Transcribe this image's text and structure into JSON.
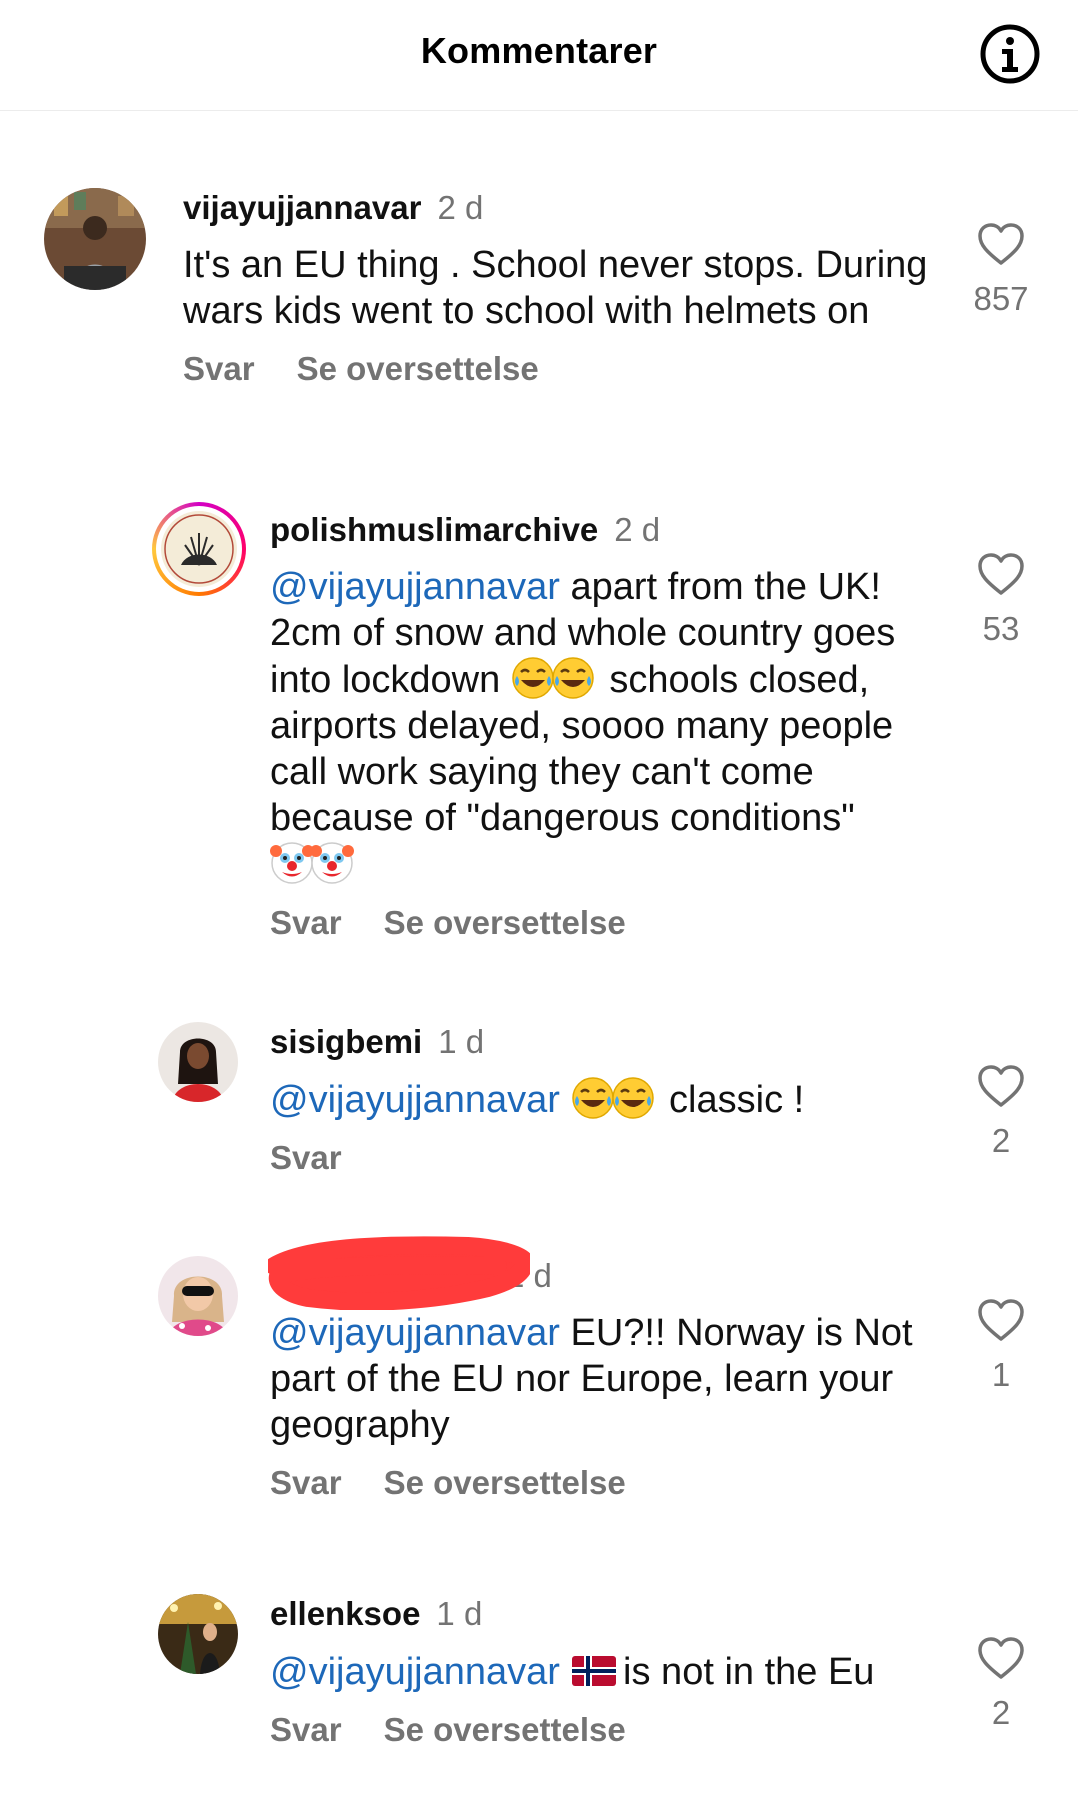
{
  "header": {
    "title": "Kommentarer",
    "info_icon": "info-circle-icon"
  },
  "colors": {
    "mention": "#1d68b9",
    "muted": "#737373",
    "redaction": "#ff3b3b"
  },
  "comments": [
    {
      "username": "vijayujjannavar",
      "time": "2 d",
      "text": "It's an EU thing . School never stops. During wars kids went to school with helmets on",
      "reply_label": "Svar",
      "translate_label": "Se oversettelse",
      "likes": "857"
    },
    {
      "username": "polishmuslimarchive",
      "time": "2 d",
      "mention": "@vijayujjannavar",
      "text_a": " apart from the UK! 2cm of snow and whole country goes into lockdown ",
      "emoji_a": "tears-of-joy-emoji",
      "text_b": " schools closed, airports delayed, soooo many people call work saying they can't come because of \"dangerous conditions\"",
      "emoji_b": "clown-face-emoji",
      "reply_label": "Svar",
      "translate_label": "Se oversettelse",
      "likes": "53"
    },
    {
      "username": "sisigbemi",
      "time": "1 d",
      "mention": "@vijayujjannavar",
      "emoji": "tears-of-joy-emoji",
      "text": " classic !",
      "reply_label": "Svar",
      "likes": "2"
    },
    {
      "username": "",
      "time": "1 d",
      "mention": "@vijayujjannavar",
      "text": " EU?!! Norway is Not part of the EU nor Europe, learn your geography",
      "reply_label": "Svar",
      "translate_label": "Se oversettelse",
      "likes": "1"
    },
    {
      "username": "ellenksoe",
      "time": "1 d",
      "mention": "@vijayujjannavar",
      "flag": "norway-flag-emoji",
      "text": " is not in the Eu",
      "reply_label": "Svar",
      "translate_label": "Se oversettelse",
      "likes": "2"
    }
  ]
}
